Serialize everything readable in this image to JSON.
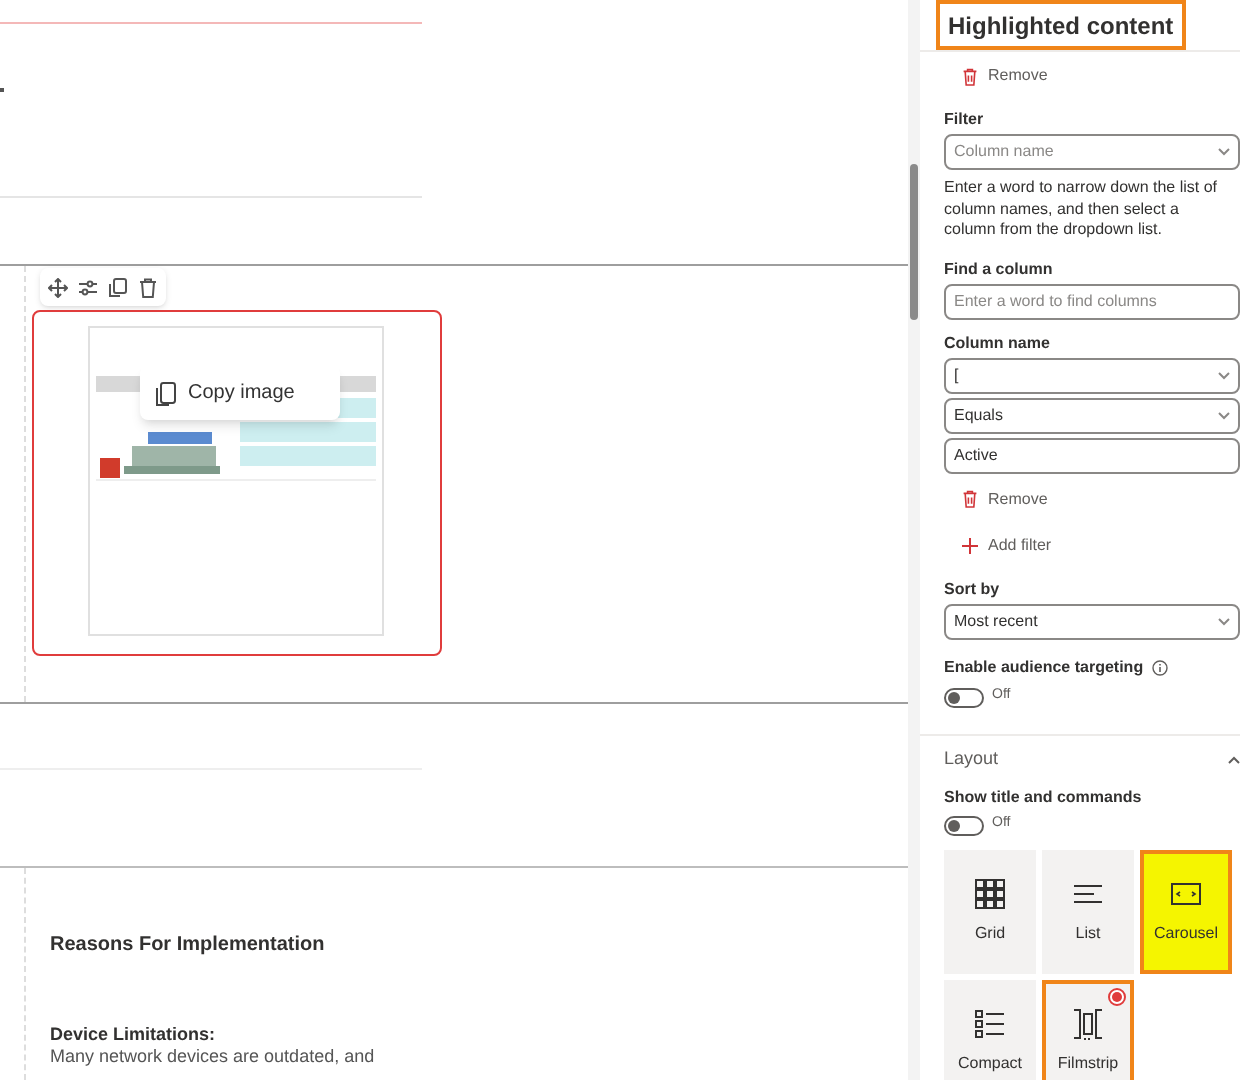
{
  "canvas": {
    "toolbar": [
      {
        "kind": "move"
      },
      {
        "kind": "sliders"
      },
      {
        "kind": "duplicate"
      },
      {
        "kind": "trash"
      }
    ],
    "image_selected": true,
    "popup": {
      "label": "Copy image"
    },
    "section_heading": "Reasons For Implementation",
    "subheading": "Device Limitations:",
    "body_text": "Many network devices are outdated, and"
  },
  "panel": {
    "title": "Highlighted content",
    "title_annotated": true,
    "controls": [
      {
        "kind": "remove",
        "label": "Remove"
      },
      {
        "kind": "label",
        "text": "Filter"
      },
      {
        "kind": "dropdown",
        "placeholder": "Column name"
      },
      {
        "kind": "help",
        "text": "Enter a word to narrow down the list of column names, and then select a column from the dropdown list."
      },
      {
        "kind": "label",
        "text": "Find a column"
      },
      {
        "kind": "input",
        "placeholder": "Enter a word to find columns"
      },
      {
        "kind": "label",
        "text": "Column name"
      },
      {
        "kind": "dropdown",
        "value": "["
      },
      {
        "kind": "dropdown",
        "value": "Equals"
      },
      {
        "kind": "input",
        "value": "Active"
      },
      {
        "kind": "remove",
        "label": "Remove"
      },
      {
        "kind": "add",
        "label": "Add filter"
      },
      {
        "kind": "label",
        "text": "Sort by"
      },
      {
        "kind": "dropdown",
        "value": "Most recent"
      },
      {
        "kind": "toggle",
        "label": "Enable audience targeting",
        "on": false,
        "state": "Off"
      }
    ],
    "layout": {
      "title": "Layout",
      "expanded": true,
      "toggle": {
        "label": "Show title and commands",
        "on": false,
        "state": "Off"
      },
      "options": [
        {
          "kind": "grid",
          "label": "Grid",
          "selected": false,
          "highlighted": false,
          "annotated": false
        },
        {
          "kind": "list",
          "label": "List",
          "selected": false,
          "highlighted": false,
          "annotated": false
        },
        {
          "kind": "carousel",
          "label": "Carousel",
          "selected": false,
          "highlighted": true,
          "annotated": true
        },
        {
          "kind": "compact",
          "label": "Compact",
          "selected": false,
          "highlighted": false,
          "annotated": false
        },
        {
          "kind": "filmstrip",
          "label": "Filmstrip",
          "selected": true,
          "highlighted": false,
          "annotated": true
        }
      ]
    }
  }
}
